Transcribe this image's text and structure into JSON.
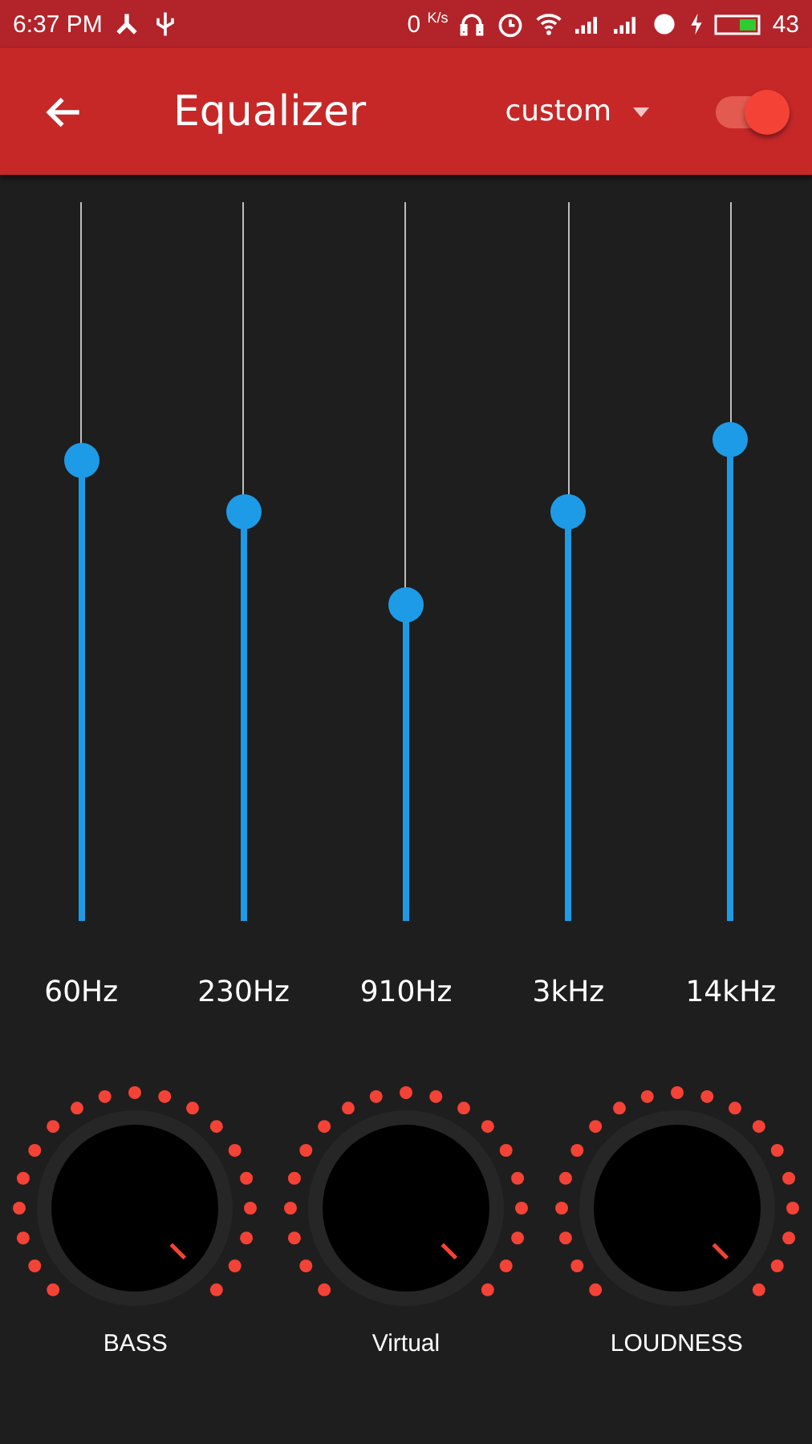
{
  "status_bar": {
    "time": "6:37 PM",
    "speed": "0",
    "speed_unit": "K/s",
    "battery": "43"
  },
  "toolbar": {
    "title": "Equalizer",
    "preset": "custom",
    "enabled": true
  },
  "bands": [
    {
      "label": "60Hz",
      "level": 0.64
    },
    {
      "label": "230Hz",
      "level": 0.57
    },
    {
      "label": "910Hz",
      "level": 0.44
    },
    {
      "label": "3kHz",
      "level": 0.57
    },
    {
      "label": "14kHz",
      "level": 0.67
    }
  ],
  "knobs": [
    {
      "label": "BASS"
    },
    {
      "label": "Virtual"
    },
    {
      "label": "LOUDNESS"
    }
  ]
}
